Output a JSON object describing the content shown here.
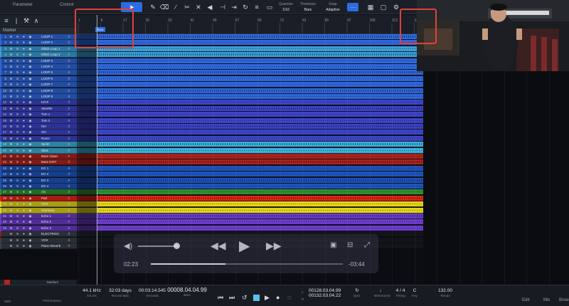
{
  "toolbar": {
    "parameter_label": "Parameter",
    "control_label": "Control",
    "quantize_label": "Quantize",
    "quantize_value": "1/16",
    "timebase_label": "Timebase",
    "timebase_value": "Bars",
    "snap_label": "Snap",
    "snap_value": "Adaptive"
  },
  "track_header": {
    "marker_label": "Marker"
  },
  "ruler": {
    "ticks": [
      "1",
      "9",
      "17",
      "25",
      "33",
      "41",
      "49",
      "57",
      "65",
      "73",
      "81",
      "89",
      "97",
      "105",
      "113",
      "121"
    ],
    "start_label": "Start"
  },
  "tracks": [
    {
      "num": "1",
      "name": "LOOP 1",
      "color": "#2f66d8"
    },
    {
      "num": "2",
      "name": "LOOP 2",
      "color": "#2f66d8"
    },
    {
      "num": "3",
      "name": "Glitch Loop 1",
      "color": "#3a9dd6"
    },
    {
      "num": "4",
      "name": "Glitch Loop 2",
      "color": "#3a9dd6"
    },
    {
      "num": "5",
      "name": "LOOP 3",
      "color": "#2f66d8"
    },
    {
      "num": "6",
      "name": "LOOP 4",
      "color": "#2f66d8"
    },
    {
      "num": "7",
      "name": "LOOP 5",
      "color": "#2f66d8"
    },
    {
      "num": "8",
      "name": "LOOP 6",
      "color": "#2f66d8"
    },
    {
      "num": "9",
      "name": "LOOP 7",
      "color": "#2f66d8"
    },
    {
      "num": "10",
      "name": "LOOP 8",
      "color": "#2f66d8"
    },
    {
      "num": "11",
      "name": "LOOP 9",
      "color": "#2f66d8"
    },
    {
      "num": "12",
      "name": "KICK",
      "color": "#3c44c4"
    },
    {
      "num": "13",
      "name": "SNARE",
      "color": "#3c44c4"
    },
    {
      "num": "14",
      "name": "Tom 1",
      "color": "#3c44c4"
    },
    {
      "num": "15",
      "name": "Tom 2",
      "color": "#3c44c4"
    },
    {
      "num": "16",
      "name": "OH",
      "color": "#3c44c4"
    },
    {
      "num": "17",
      "name": "OH",
      "color": "#3c44c4"
    },
    {
      "num": "18",
      "name": "Room",
      "color": "#3c44c4"
    },
    {
      "num": "19",
      "name": "Synth",
      "color": "#3ab0d8"
    },
    {
      "num": "20",
      "name": "Stick",
      "color": "#3ab0d8"
    },
    {
      "num": "21",
      "name": "Bass Clean",
      "color": "#a8231f"
    },
    {
      "num": "22",
      "name": "Bass DIST",
      "color": "#a8231f"
    },
    {
      "num": "23",
      "name": "EG 1",
      "color": "#1f52b8"
    },
    {
      "num": "24",
      "name": "EG 2",
      "color": "#1f52b8"
    },
    {
      "num": "25",
      "name": "EG 3",
      "color": "#1f52b8"
    },
    {
      "num": "26",
      "name": "EG 4",
      "color": "#1f52b8"
    },
    {
      "num": "27",
      "name": "AG",
      "color": "#2f8f2f"
    },
    {
      "num": "28",
      "name": "Pad",
      "color": "#e0231c"
    },
    {
      "num": "29",
      "name": "VOX",
      "color": "#e0d21c"
    },
    {
      "num": "30",
      "name": "Harmony",
      "color": "#e0d21c"
    },
    {
      "num": "31",
      "name": "Echo 1",
      "color": "#6a3cc8"
    },
    {
      "num": "32",
      "name": "Echo 2",
      "color": "#6a3cc8"
    },
    {
      "num": "33",
      "name": "Echo 3",
      "color": "#6a3cc8"
    }
  ],
  "extra_tracks": [
    {
      "label": "ELECTRICK",
      "color": "#8a1d1d"
    },
    {
      "label": "VOX",
      "color": "#3a3f48"
    },
    {
      "label": "Piano Reverb",
      "color": "#3a3f48"
    }
  ],
  "player": {
    "elapsed": "02:23",
    "remaining": "-03:44",
    "progress": 0.39
  },
  "transport": {
    "sample_rate": "44.1 kHz",
    "sample_rate_sub": "9.6 ms",
    "record_max": "32:03 days",
    "record_max_label": "Record Max",
    "seconds": "00:03:14.545",
    "seconds_label": "Seconds",
    "bars": "00008.04.04.99",
    "bars_label": "Bars",
    "left_loc": "00128.03.04.99",
    "right_loc": "00132.03.04.22",
    "sync_label": "Sync",
    "timing": "4 / 4",
    "timing_label": "Timing",
    "key": "C",
    "key_label": "Key",
    "tempo": "132.00",
    "tempo_label": "Tempo",
    "metronome_label": "Metronome",
    "perf_label": "Performance",
    "midi_label": "MIDI",
    "edit_label": "Edit",
    "mix_label": "Mix",
    "browse_label": "Brow"
  },
  "bottom_left": {
    "medium_label": "Medium"
  }
}
